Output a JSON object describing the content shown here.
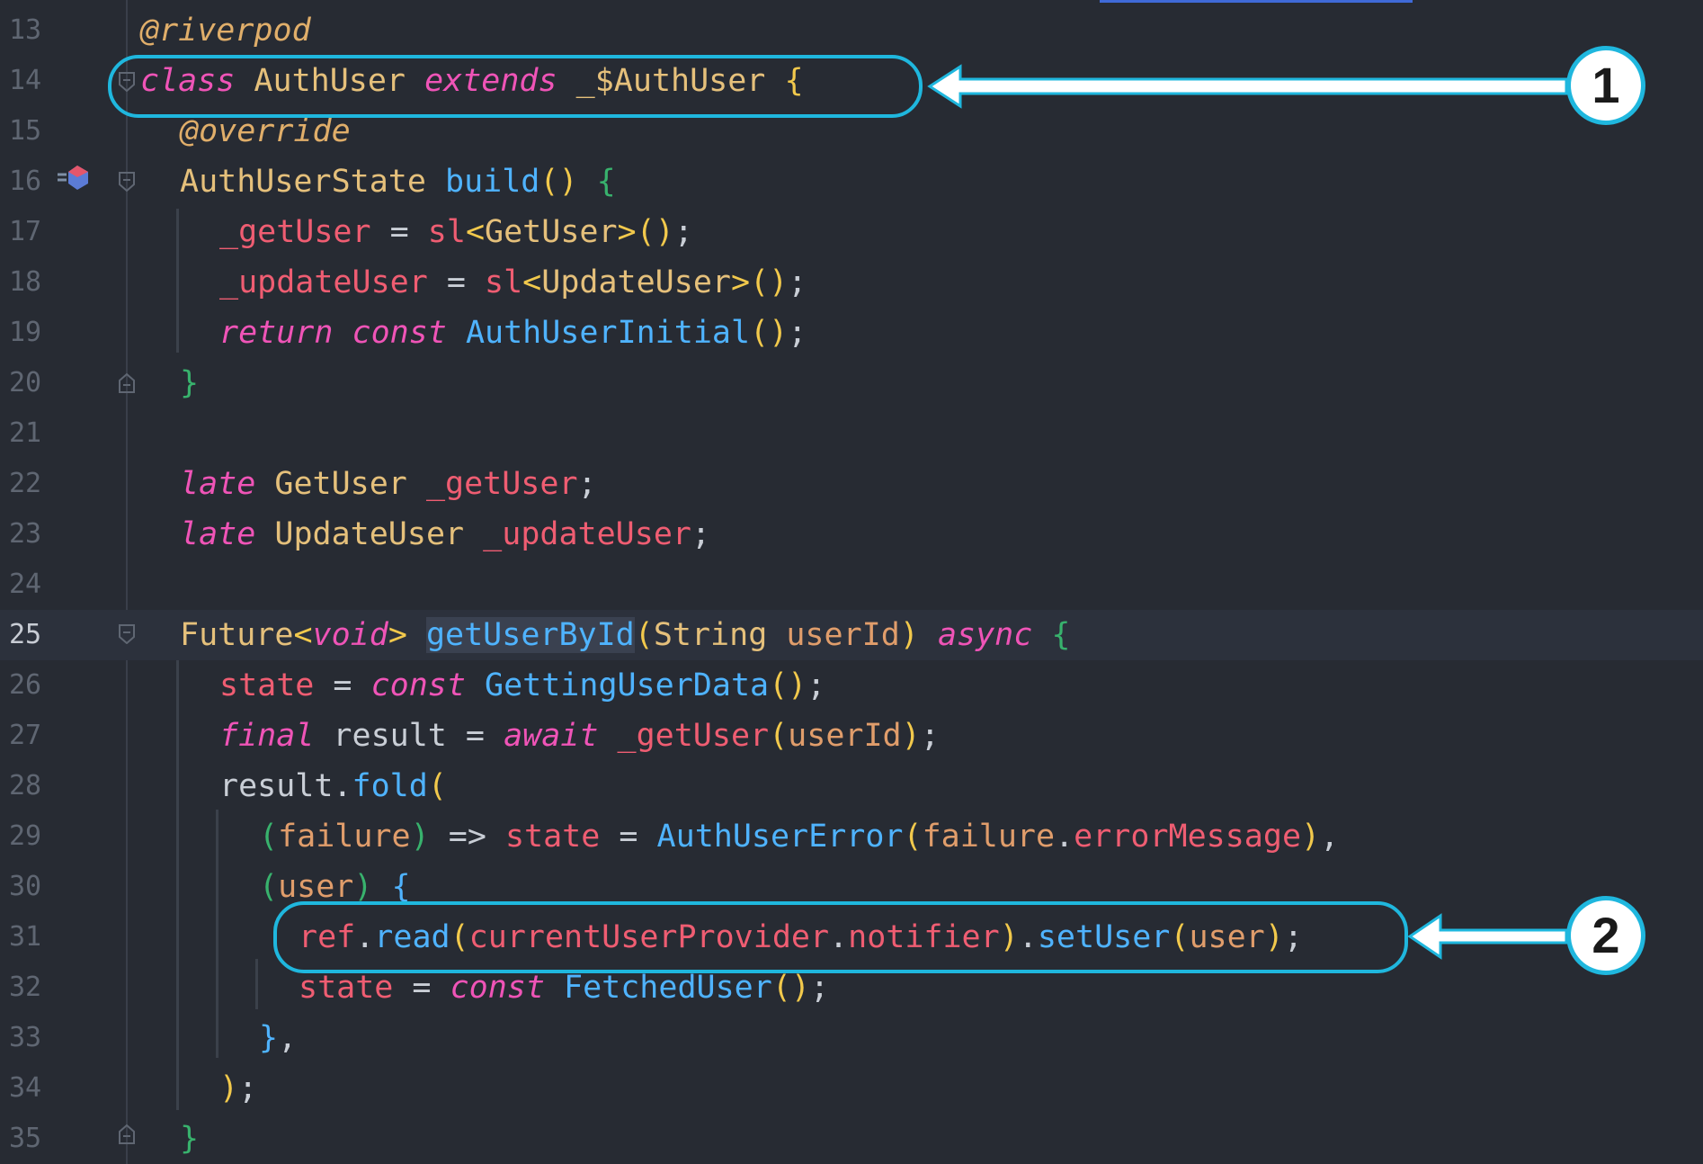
{
  "editor": {
    "lines": [
      {
        "num": "13",
        "tokens": [
          {
            "t": "@riverpod",
            "c": "ann"
          }
        ]
      },
      {
        "num": "14",
        "tokens": [
          {
            "t": "class",
            "c": "kw"
          },
          {
            "t": " AuthUser ",
            "c": "type"
          },
          {
            "t": "extends",
            "c": "kw"
          },
          {
            "t": " _$AuthUser ",
            "c": "type"
          },
          {
            "t": "{",
            "c": "p1"
          }
        ]
      },
      {
        "num": "15",
        "tokens": [
          {
            "t": "@override",
            "c": "ann"
          }
        ]
      },
      {
        "num": "16",
        "tokens": [
          {
            "t": "AuthUserState ",
            "c": "type"
          },
          {
            "t": "build",
            "c": "fn"
          },
          {
            "t": "()",
            "c": "p1"
          },
          {
            "t": " ",
            "c": "punc"
          },
          {
            "t": "{",
            "c": "p3"
          }
        ]
      },
      {
        "num": "17",
        "tokens": [
          {
            "t": "_getUser",
            "c": "var"
          },
          {
            "t": " = ",
            "c": "punc"
          },
          {
            "t": "sl",
            "c": "var"
          },
          {
            "t": "<",
            "c": "p1"
          },
          {
            "t": "GetUser",
            "c": "type"
          },
          {
            "t": ">",
            "c": "p1"
          },
          {
            "t": "()",
            "c": "p1"
          },
          {
            "t": ";",
            "c": "punc"
          }
        ]
      },
      {
        "num": "18",
        "tokens": [
          {
            "t": "_updateUser",
            "c": "var"
          },
          {
            "t": " = ",
            "c": "punc"
          },
          {
            "t": "sl",
            "c": "var"
          },
          {
            "t": "<",
            "c": "p1"
          },
          {
            "t": "UpdateUser",
            "c": "type"
          },
          {
            "t": ">",
            "c": "p1"
          },
          {
            "t": "()",
            "c": "p1"
          },
          {
            "t": ";",
            "c": "punc"
          }
        ]
      },
      {
        "num": "19",
        "tokens": [
          {
            "t": "return",
            "c": "kw"
          },
          {
            "t": " ",
            "c": "punc"
          },
          {
            "t": "const",
            "c": "kw"
          },
          {
            "t": " ",
            "c": "punc"
          },
          {
            "t": "AuthUserInitial",
            "c": "fn"
          },
          {
            "t": "()",
            "c": "p1"
          },
          {
            "t": ";",
            "c": "punc"
          }
        ]
      },
      {
        "num": "20",
        "tokens": [
          {
            "t": "}",
            "c": "p3"
          }
        ]
      },
      {
        "num": "21",
        "tokens": []
      },
      {
        "num": "22",
        "tokens": [
          {
            "t": "late",
            "c": "kw"
          },
          {
            "t": " GetUser ",
            "c": "type"
          },
          {
            "t": "_getUser",
            "c": "var"
          },
          {
            "t": ";",
            "c": "punc"
          }
        ]
      },
      {
        "num": "23",
        "tokens": [
          {
            "t": "late",
            "c": "kw"
          },
          {
            "t": " UpdateUser ",
            "c": "type"
          },
          {
            "t": "_updateUser",
            "c": "var"
          },
          {
            "t": ";",
            "c": "punc"
          }
        ]
      },
      {
        "num": "24",
        "tokens": []
      },
      {
        "num": "25",
        "tokens": [
          {
            "t": "Future",
            "c": "type"
          },
          {
            "t": "<",
            "c": "p1"
          },
          {
            "t": "void",
            "c": "kw"
          },
          {
            "t": ">",
            "c": "p1"
          },
          {
            "t": " ",
            "c": "punc"
          },
          {
            "t": "getUserById",
            "c": "fn",
            "hl": true
          },
          {
            "t": "(",
            "c": "p1"
          },
          {
            "t": "String ",
            "c": "type"
          },
          {
            "t": "userId",
            "c": "param"
          },
          {
            "t": ")",
            "c": "p1"
          },
          {
            "t": " ",
            "c": "punc"
          },
          {
            "t": "async",
            "c": "kw"
          },
          {
            "t": " ",
            "c": "punc"
          },
          {
            "t": "{",
            "c": "p3"
          }
        ]
      },
      {
        "num": "26",
        "tokens": [
          {
            "t": "state",
            "c": "var"
          },
          {
            "t": " = ",
            "c": "punc"
          },
          {
            "t": "const",
            "c": "kw"
          },
          {
            "t": " ",
            "c": "punc"
          },
          {
            "t": "GettingUserData",
            "c": "fn"
          },
          {
            "t": "()",
            "c": "p1"
          },
          {
            "t": ";",
            "c": "punc"
          }
        ]
      },
      {
        "num": "27",
        "tokens": [
          {
            "t": "final",
            "c": "kw"
          },
          {
            "t": " result = ",
            "c": "punc"
          },
          {
            "t": "await",
            "c": "kw"
          },
          {
            "t": " ",
            "c": "punc"
          },
          {
            "t": "_getUser",
            "c": "var"
          },
          {
            "t": "(",
            "c": "p1"
          },
          {
            "t": "userId",
            "c": "param"
          },
          {
            "t": ")",
            "c": "p1"
          },
          {
            "t": ";",
            "c": "punc"
          }
        ]
      },
      {
        "num": "28",
        "tokens": [
          {
            "t": "result.",
            "c": "punc"
          },
          {
            "t": "fold",
            "c": "fn"
          },
          {
            "t": "(",
            "c": "p1"
          }
        ]
      },
      {
        "num": "29",
        "tokens": [
          {
            "t": "(",
            "c": "p3"
          },
          {
            "t": "failure",
            "c": "param"
          },
          {
            "t": ")",
            "c": "p3"
          },
          {
            "t": " => ",
            "c": "punc"
          },
          {
            "t": "state",
            "c": "var"
          },
          {
            "t": " = ",
            "c": "punc"
          },
          {
            "t": "AuthUserError",
            "c": "fn"
          },
          {
            "t": "(",
            "c": "p1"
          },
          {
            "t": "failure",
            "c": "param"
          },
          {
            "t": ".",
            "c": "punc"
          },
          {
            "t": "errorMessage",
            "c": "var"
          },
          {
            "t": ")",
            "c": "p1"
          },
          {
            "t": ",",
            "c": "punc"
          }
        ]
      },
      {
        "num": "30",
        "tokens": [
          {
            "t": "(",
            "c": "p3"
          },
          {
            "t": "user",
            "c": "param"
          },
          {
            "t": ")",
            "c": "p3"
          },
          {
            "t": " ",
            "c": "punc"
          },
          {
            "t": "{",
            "c": "p2"
          }
        ]
      },
      {
        "num": "31",
        "tokens": [
          {
            "t": "ref",
            "c": "var"
          },
          {
            "t": ".",
            "c": "punc"
          },
          {
            "t": "read",
            "c": "fn"
          },
          {
            "t": "(",
            "c": "p1"
          },
          {
            "t": "currentUserProvider",
            "c": "var"
          },
          {
            "t": ".",
            "c": "punc"
          },
          {
            "t": "notifier",
            "c": "var"
          },
          {
            "t": ")",
            "c": "p1"
          },
          {
            "t": ".",
            "c": "punc"
          },
          {
            "t": "setUser",
            "c": "fn"
          },
          {
            "t": "(",
            "c": "p1"
          },
          {
            "t": "user",
            "c": "param"
          },
          {
            "t": ")",
            "c": "p1"
          },
          {
            "t": ";",
            "c": "punc"
          }
        ]
      },
      {
        "num": "32",
        "tokens": [
          {
            "t": "state",
            "c": "var"
          },
          {
            "t": " = ",
            "c": "punc"
          },
          {
            "t": "const",
            "c": "kw"
          },
          {
            "t": " ",
            "c": "punc"
          },
          {
            "t": "FetchedUser",
            "c": "fn"
          },
          {
            "t": "()",
            "c": "p1"
          },
          {
            "t": ";",
            "c": "punc"
          }
        ]
      },
      {
        "num": "33",
        "tokens": [
          {
            "t": "}",
            "c": "p2"
          },
          {
            "t": ",",
            "c": "punc"
          }
        ]
      },
      {
        "num": "34",
        "tokens": [
          {
            "t": ")",
            "c": "p1"
          },
          {
            "t": ";",
            "c": "punc"
          }
        ]
      },
      {
        "num": "35",
        "tokens": [
          {
            "t": "}",
            "c": "p3"
          }
        ]
      }
    ]
  },
  "callouts": [
    {
      "label": "1"
    },
    {
      "label": "2"
    }
  ],
  "colors": {
    "background": "#272b33",
    "callout": "#1fb7de",
    "keyword": "#ef54b7",
    "type": "#e5c07b",
    "function": "#4fb3ff",
    "variable": "#ef5d72"
  }
}
